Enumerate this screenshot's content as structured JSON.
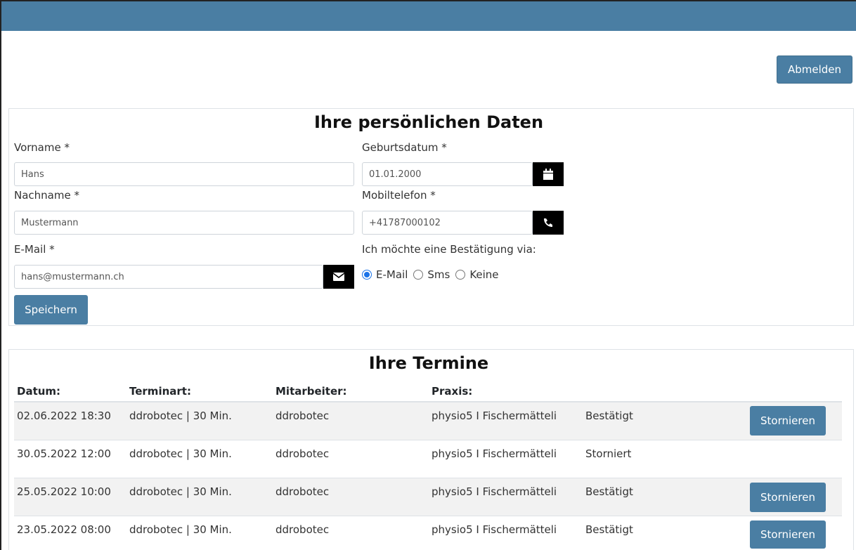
{
  "header": {
    "logout_label": "Abmelden"
  },
  "personal": {
    "title": "Ihre persönlichen Daten",
    "firstname": {
      "label": "Vorname *",
      "value": "Hans"
    },
    "lastname": {
      "label": "Nachname *",
      "value": "Mustermann"
    },
    "email": {
      "label": "E-Mail *",
      "value": "hans@mustermann.ch",
      "icon": "envelope-icon"
    },
    "birthdate": {
      "label": "Geburtsdatum *",
      "value": "01.01.2000",
      "icon": "calendar-icon"
    },
    "mobile": {
      "label": "Mobiltelefon *",
      "value": "+41787000102",
      "icon": "phone-icon"
    },
    "confirmation": {
      "label": "Ich möchte eine Bestätigung via:",
      "options": [
        "E-Mail",
        "Sms",
        "Keine"
      ],
      "selected": "E-Mail"
    },
    "save_label": "Speichern"
  },
  "appointments": {
    "title": "Ihre Termine",
    "columns": [
      "Datum:",
      "Terminart:",
      "Mitarbeiter:",
      "Praxis:"
    ],
    "rows": [
      {
        "date": "02.06.2022 18:30",
        "type": "ddrobotec | 30 Min.",
        "staff": "ddrobotec",
        "practice": "physio5 I Fischermätteli",
        "status": "Bestätigt",
        "action": "Stornieren"
      },
      {
        "date": "30.05.2022 12:00",
        "type": "ddrobotec | 30 Min.",
        "staff": "ddrobotec",
        "practice": "physio5 I Fischermätteli",
        "status": "Storniert",
        "action": ""
      },
      {
        "date": "25.05.2022 10:00",
        "type": "ddrobotec | 30 Min.",
        "staff": "ddrobotec",
        "practice": "physio5 I Fischermätteli",
        "status": "Bestätigt",
        "action": "Stornieren"
      },
      {
        "date": "23.05.2022 08:00",
        "type": "ddrobotec | 30 Min.",
        "staff": "ddrobotec",
        "practice": "physio5 I Fischermätteli",
        "status": "Bestätigt",
        "action": "Stornieren"
      }
    ]
  },
  "colors": {
    "primary": "#4a7ea3",
    "icon_bg": "#000000",
    "stripe": "#f2f2f2"
  }
}
